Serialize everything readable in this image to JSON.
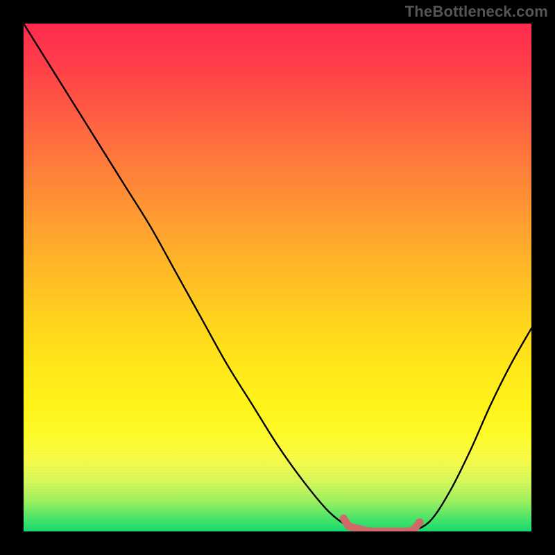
{
  "watermark": "TheBottleneck.com",
  "chart_data": {
    "type": "line",
    "title": "",
    "xlabel": "",
    "ylabel": "",
    "xlim": [
      0,
      100
    ],
    "ylim": [
      0,
      100
    ],
    "x": [
      0,
      5,
      10,
      15,
      20,
      25,
      30,
      35,
      40,
      45,
      50,
      55,
      60,
      64,
      68,
      72,
      76,
      80,
      84,
      88,
      92,
      96,
      100
    ],
    "values": [
      100,
      92,
      84,
      76,
      68,
      60,
      51,
      42,
      33,
      25,
      17,
      10,
      4,
      1,
      0,
      0,
      0,
      2,
      8,
      16,
      25,
      33,
      40
    ],
    "annotations": [
      {
        "kind": "trough-highlight",
        "x_start": 63,
        "x_end": 78,
        "color": "#d06a6a"
      }
    ],
    "background": {
      "kind": "vertical-gradient",
      "stops": [
        {
          "pos": 0.0,
          "color": "#ff2a4f"
        },
        {
          "pos": 0.5,
          "color": "#ffc824"
        },
        {
          "pos": 0.82,
          "color": "#fdfb30"
        },
        {
          "pos": 1.0,
          "color": "#17d970"
        }
      ]
    }
  }
}
